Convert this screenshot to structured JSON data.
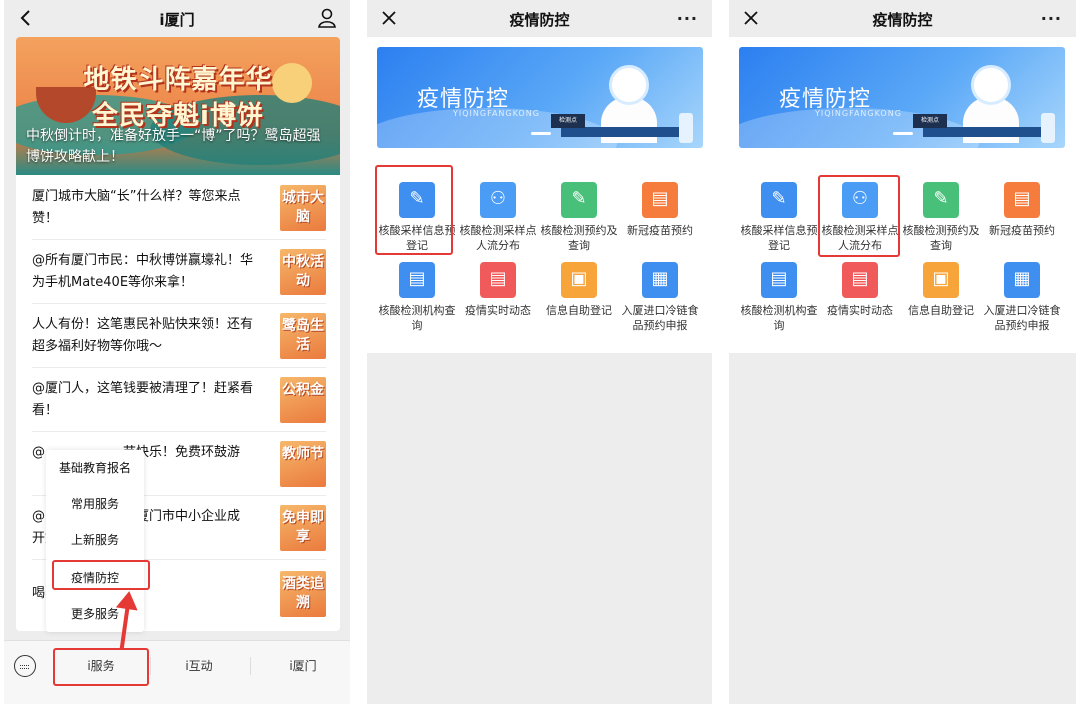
{
  "colors": {
    "highlight": "#e53935",
    "service_blue": "#2c7ff0",
    "tag_orange": "#ea7a3d"
  },
  "panel1": {
    "nav": {
      "title": "i厦门",
      "back_icon": "back-chevron-icon",
      "profile_icon": "person-icon"
    },
    "banner": {
      "line1": "地铁斗阵嘉年华",
      "line2": "全民夺魁i博饼",
      "caption": "中秋倒计时，准备好放手一“博”了吗？鹭岛超强博饼攻略献上！"
    },
    "articles": [
      {
        "text": "厦门城市大脑“长”什么样？等您来点赞！",
        "tag": "城市大脑"
      },
      {
        "text": "@所有厦门市民：中秋博饼赢壕礼！华为手机Mate40E等你来拿！",
        "tag": "中秋活动"
      },
      {
        "text": "人人有份！这笔惠民补贴快来领！还有超多福利好物等你哦～",
        "tag": "鹭岛生活"
      },
      {
        "text": "@厦门人，这笔钱要被清理了！赶紧看看！",
        "tag": "公积金"
      },
      {
        "text": "@　　　　　　节快乐！免费环鼓游",
        "tag": "教师节"
      },
      {
        "text": "@　　　　　　年厦门市中小企业成　　　　　　开始！上“免申即",
        "tag": "免申即享"
      },
      {
        "text": "喝　　　　　　吗?",
        "tag": "酒类追溯"
      }
    ],
    "menu": [
      "基础教育报名",
      "常用服务",
      "上新服务",
      "疫情防控",
      "更多服务"
    ],
    "tabbar": {
      "keyboard_icon": "keyboard-icon",
      "tabs": [
        "i服务",
        "i互动",
        "i厦门"
      ]
    }
  },
  "panel2": {
    "nav": {
      "title": "疫情防控",
      "close_icon": "close-icon",
      "more": "···"
    },
    "hero": {
      "title": "疫情防控",
      "subtitle": "YIQINGFANGKONG",
      "plaque": "检测点"
    },
    "services": [
      {
        "label": "核酸采样信息预登记",
        "icon": "test-tube-icon",
        "color": "#3f8ff0"
      },
      {
        "label": "核酸检测采样点人流分布",
        "icon": "people-icon",
        "color": "#4a9cf5"
      },
      {
        "label": "核酸检测预约及查询",
        "icon": "test-tube-icon",
        "color": "#48c07a"
      },
      {
        "label": "新冠疫苗预约",
        "icon": "document-icon",
        "color": "#f57c3d"
      },
      {
        "label": "核酸检测机构查询",
        "icon": "document-icon",
        "color": "#3f8ff0"
      },
      {
        "label": "疫情实时动态",
        "icon": "document-icon",
        "color": "#f05a5a"
      },
      {
        "label": "信息自助登记",
        "icon": "id-card-icon",
        "color": "#f7a43b"
      },
      {
        "label": "入厦进口冷链食品预约申报",
        "icon": "calendar-icon",
        "color": "#3f8ff0"
      }
    ]
  },
  "panel3": {
    "nav": {
      "title": "疫情防控",
      "close_icon": "close-icon",
      "more": "···"
    },
    "hero": {
      "title": "疫情防控",
      "subtitle": "YIQINGFANGKONG",
      "plaque": "检测点"
    }
  }
}
